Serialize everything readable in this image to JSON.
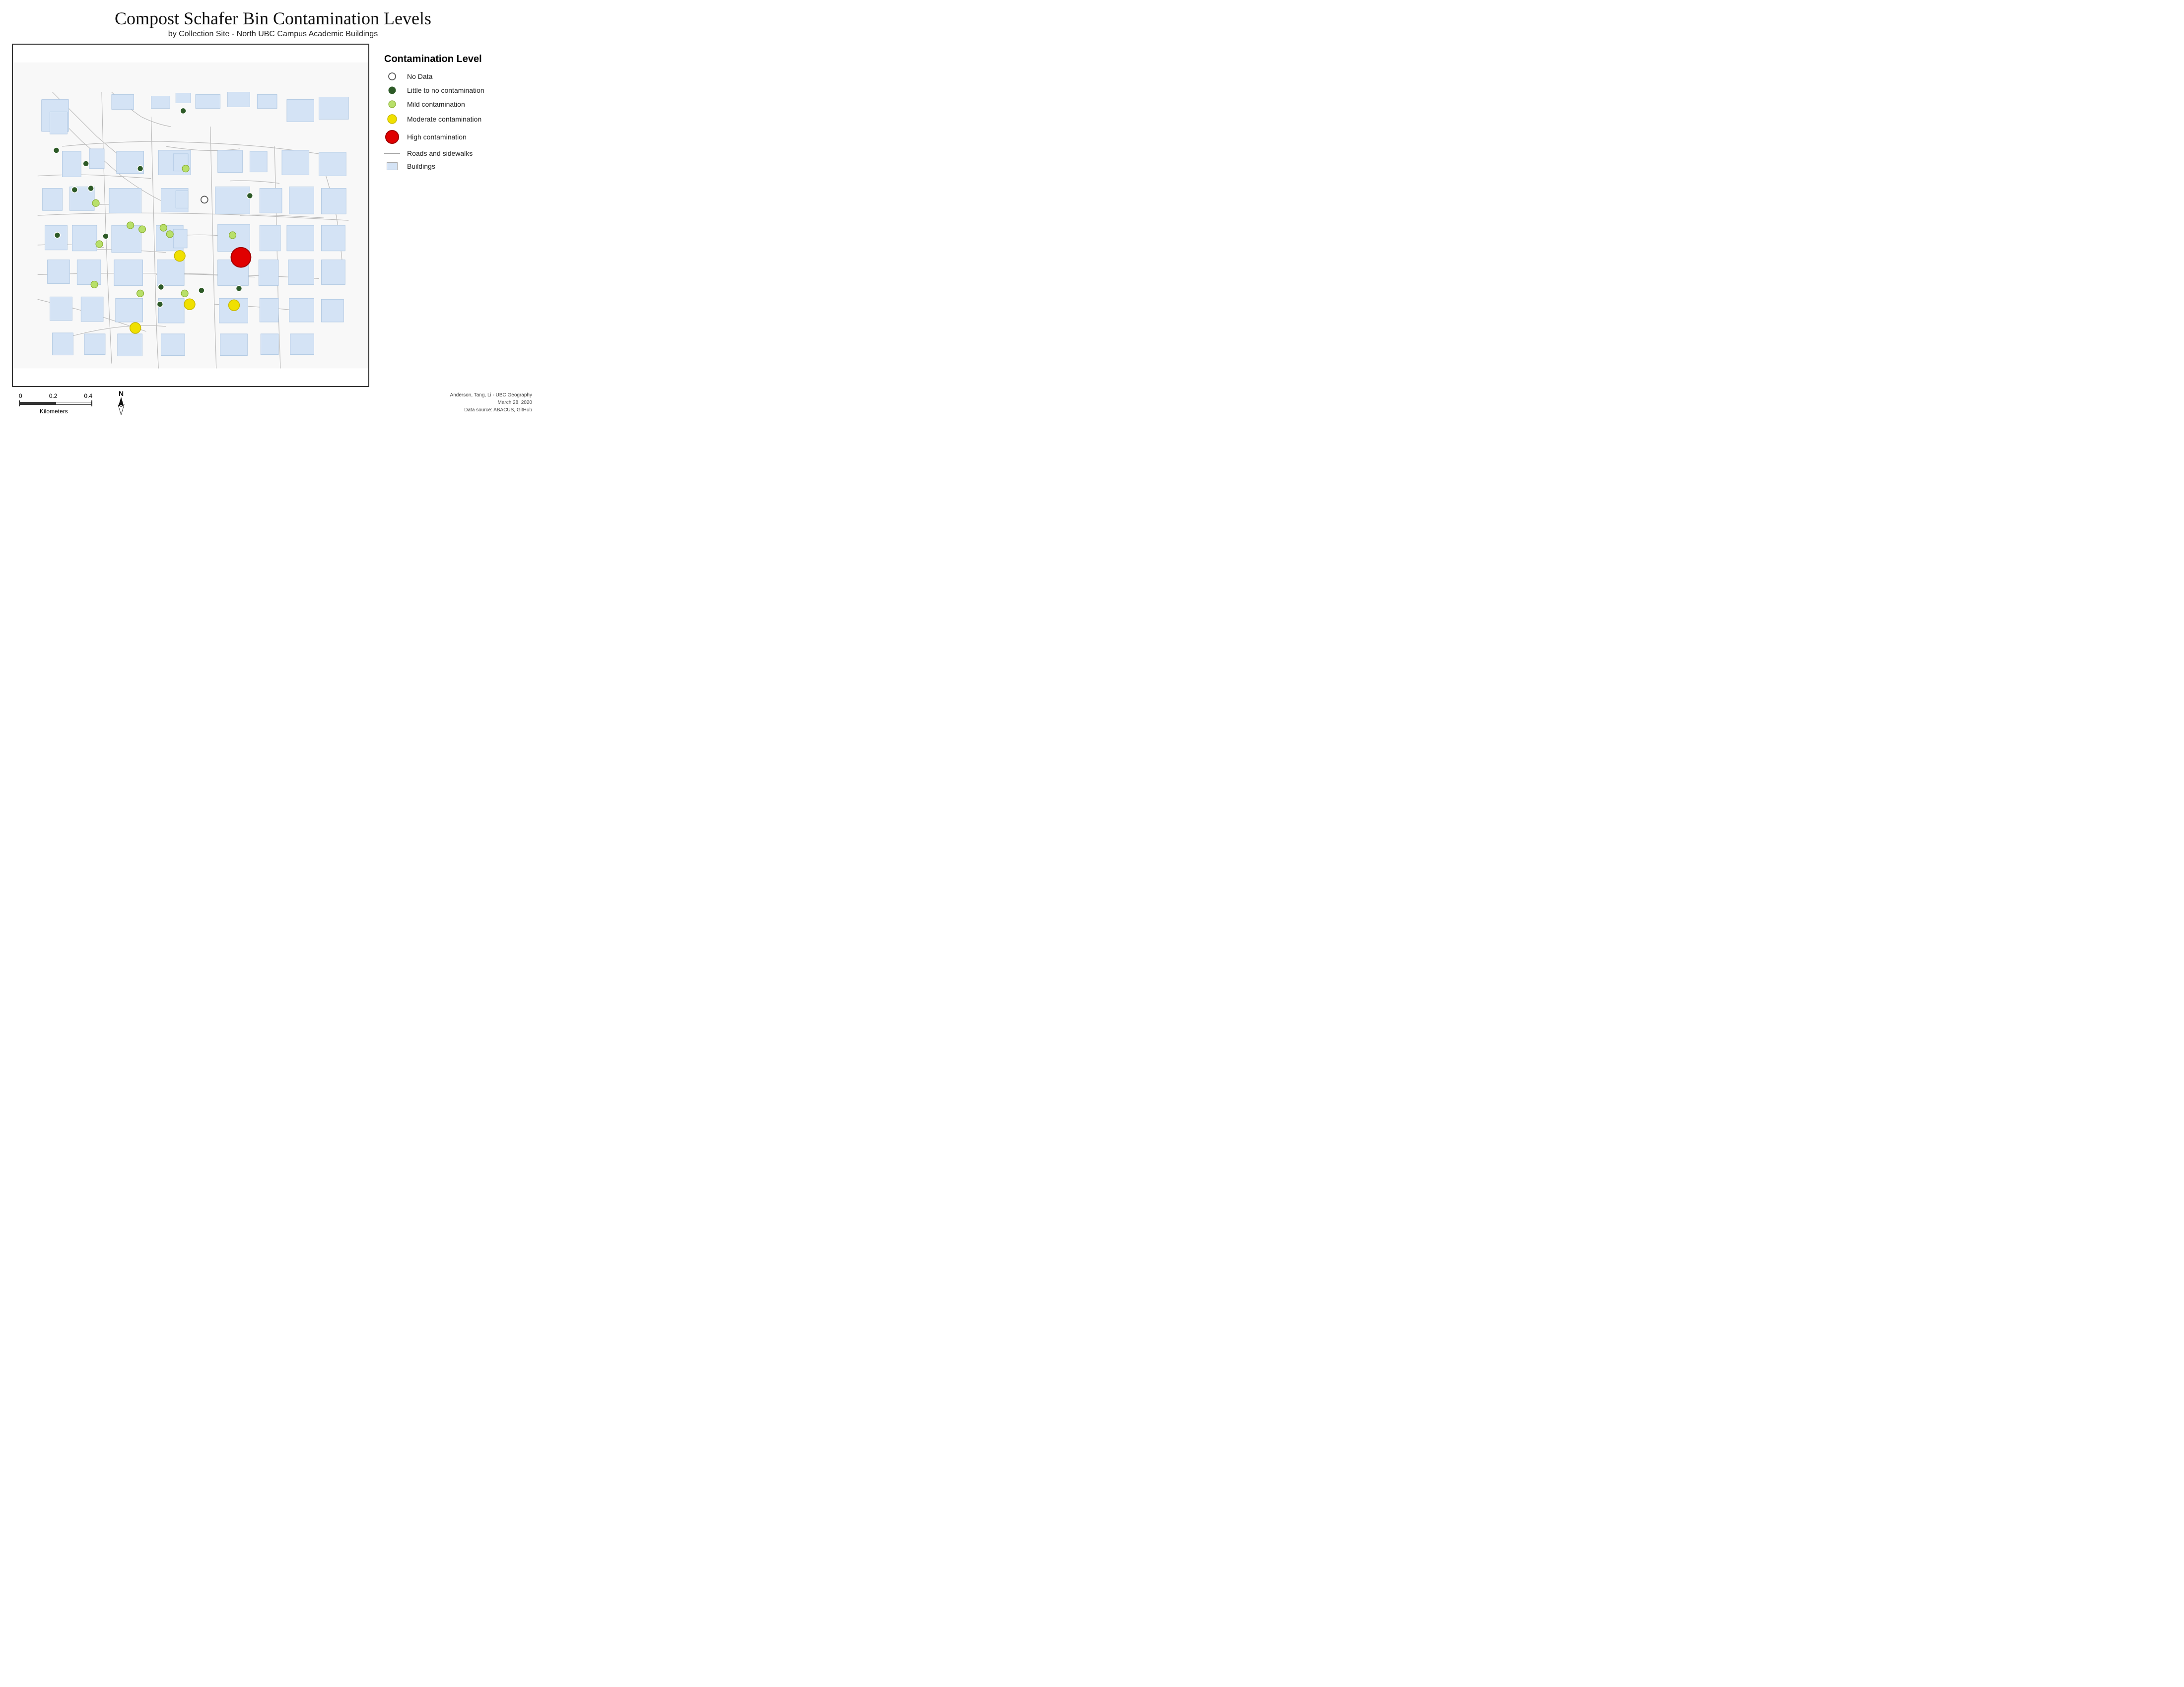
{
  "title": {
    "main": "Compost Schafer Bin Contamination Levels",
    "sub": "by Collection Site - North UBC Campus Academic Buildings"
  },
  "legend": {
    "heading": "Contamination Level",
    "items": [
      {
        "id": "no-data",
        "label": "No Data",
        "type": "circle",
        "fill": "white",
        "stroke": "#555",
        "size": 14
      },
      {
        "id": "little",
        "label": "Little to no contamination",
        "type": "circle",
        "fill": "#2d5a27",
        "stroke": "#2d5a27",
        "size": 14
      },
      {
        "id": "mild",
        "label": "Mild contamination",
        "type": "circle",
        "fill": "#b8e06a",
        "stroke": "#8aad30",
        "size": 14
      },
      {
        "id": "moderate",
        "label": "Moderate contamination",
        "type": "circle",
        "fill": "#f0e000",
        "stroke": "#c8b800",
        "size": 18
      },
      {
        "id": "high",
        "label": "High contamination",
        "type": "circle",
        "fill": "#e00000",
        "stroke": "#a00000",
        "size": 24
      },
      {
        "id": "roads",
        "label": "Roads and sidewalks",
        "type": "line"
      },
      {
        "id": "buildings",
        "label": "Buildings",
        "type": "rect"
      }
    ]
  },
  "scale": {
    "labels": [
      "0",
      "0.2",
      "0.4"
    ],
    "unit": "Kilometers"
  },
  "attribution": {
    "line1": "Anderson, Tang, Li - UBC Geography",
    "line2": "March 28, 2020",
    "line3": "Data source: ABACUS, GitHub"
  }
}
